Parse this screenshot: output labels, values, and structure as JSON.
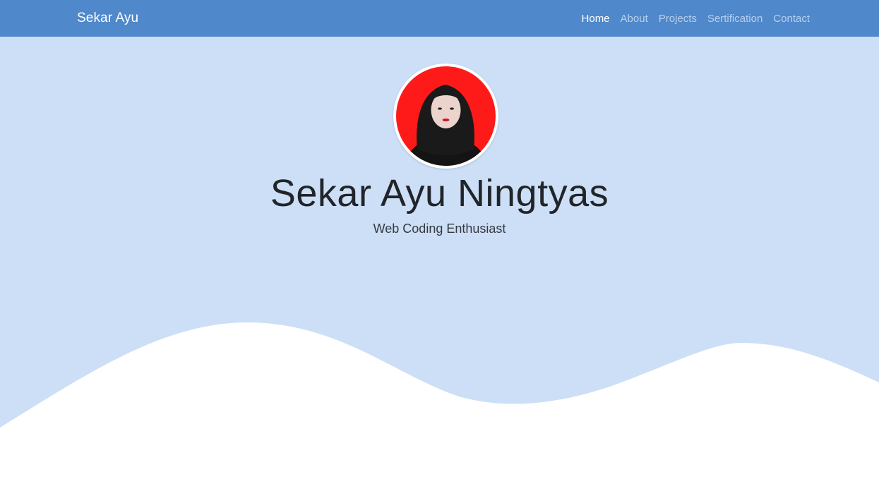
{
  "navbar": {
    "brand": "Sekar Ayu",
    "links": [
      {
        "label": "Home",
        "active": true
      },
      {
        "label": "About",
        "active": false
      },
      {
        "label": "Projects",
        "active": false
      },
      {
        "label": "Sertification",
        "active": false
      },
      {
        "label": "Contact",
        "active": false
      }
    ]
  },
  "hero": {
    "name": "Sekar Ayu Ningtyas",
    "tagline": "Web Coding Enthusiast",
    "profile_photo": "profile-photo"
  },
  "colors": {
    "navbar_bg": "#4f88cb",
    "hero_bg": "#cddff6",
    "wave": "#ffffff",
    "photo_bg": "#ff1a1a"
  }
}
